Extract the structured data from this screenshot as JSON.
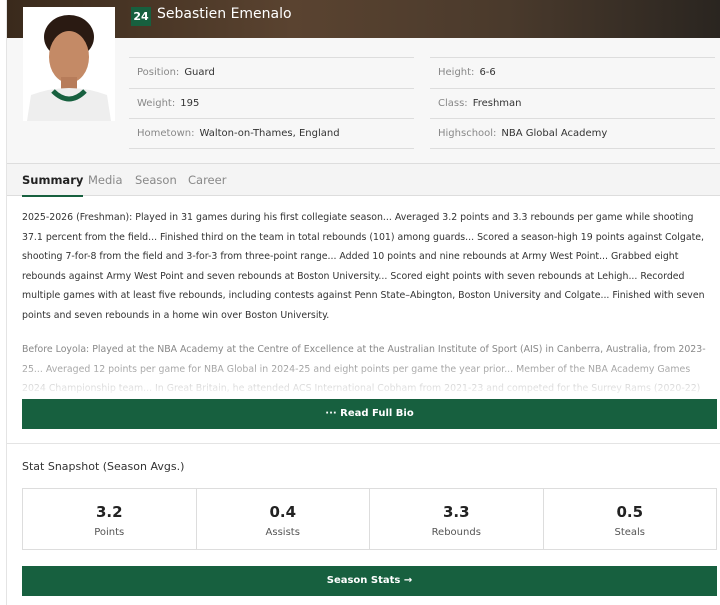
{
  "player": {
    "number": "24",
    "name": "Sebastien Emenalo"
  },
  "info_left": [
    {
      "label": "Position:",
      "value": "Guard"
    },
    {
      "label": "Weight:",
      "value": "195"
    },
    {
      "label": "Hometown:",
      "value": "Walton-on-Thames, England"
    }
  ],
  "info_right": [
    {
      "label": "Height:",
      "value": "6-6"
    },
    {
      "label": "Class:",
      "value": "Freshman"
    },
    {
      "label": "Highschool:",
      "value": "NBA Global Academy"
    }
  ],
  "tabs": [
    "Summary",
    "Media",
    "Season",
    "Career"
  ],
  "bio": {
    "p1": "2025-2026 (Freshman): Played in 31 games during his first collegiate season... Averaged 3.2 points and 3.3 rebounds per game while shooting 37.1 percent from the field... Finished third on the team in total rebounds (101) among guards... Scored a season-high 19 points against Colgate, shooting 7-for-8 from the field and 3-for-3 from three-point range... Added 10 points and nine rebounds at Army West Point... Grabbed eight rebounds against Army West Point and seven rebounds at Boston University... Scored eight points with seven rebounds at Lehigh... Recorded multiple games with at least five rebounds, including contests against Penn State–Abington, Boston University and Colgate... Finished with seven points and seven rebounds in a home win over Boston University.",
    "p2": "Before Loyola: Played at the NBA Academy at the Centre of Excellence at the Australian Institute of Sport (AIS) in Canberra, Australia, from 2023-25... Averaged 12 points per game for NBA Global in 2024-25 and eight points per game the year prior... Member of the NBA Academy Games 2024 Championship team... In Great Britain, he attended ACS International Cobham from 2021-23 and competed for the Surrey Rams (2020-22) and the",
    "read_more": "··· Read Full Bio"
  },
  "snapshot": {
    "title": "Stat Snapshot (Season Avgs.)",
    "stats": [
      {
        "value": "3.2",
        "label": "Points"
      },
      {
        "value": "0.4",
        "label": "Assists"
      },
      {
        "value": "3.3",
        "label": "Rebounds"
      },
      {
        "value": "0.5",
        "label": "Steals"
      }
    ],
    "button": "Season Stats →"
  },
  "colors": {
    "accent": "#17603f"
  }
}
